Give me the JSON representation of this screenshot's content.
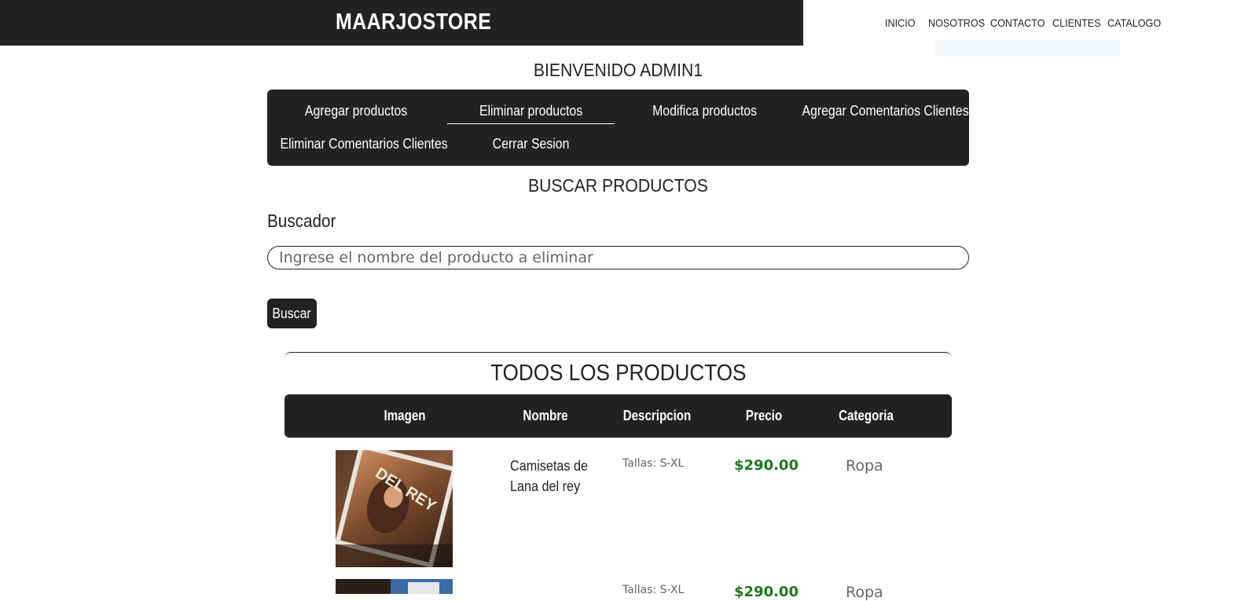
{
  "header": {
    "brand": "MAARJOSTORE",
    "nav": [
      "INICIO",
      "NOSOTROS",
      "CONTACTO",
      "CLIENTES",
      "CATALOGO"
    ]
  },
  "welcome": "BIENVENIDO ADMIN1",
  "admin_menu": {
    "items": [
      "Agregar productos",
      "Eliminar productos",
      "Modifica productos",
      "Agregar Comentarios Clientes",
      "Eliminar Comentarios Clientes",
      "Cerrar Sesion"
    ],
    "active": "Eliminar productos"
  },
  "search": {
    "title": "BUSCAR PRODUCTOS",
    "label": "Buscador",
    "placeholder": "Ingrese el nombre del producto a eliminar",
    "button": "Buscar"
  },
  "products": {
    "title": "TODOS LOS PRODUCTOS",
    "columns": [
      "Imagen",
      "Nombre",
      "Descripcion",
      "Precio",
      "Categoria"
    ],
    "rows": [
      {
        "image": "lana-del-rey-album-photo",
        "name": "Camisetas de Lana del rey",
        "description": "Tallas: S-XL",
        "price": "$290.00",
        "category": "Ropa"
      },
      {
        "image": "product-photo",
        "name": "",
        "description": "Tallas: S-XL",
        "price": "$290.00",
        "category": "Ropa"
      }
    ]
  },
  "colors": {
    "dark": "#222222",
    "price": "#1a7a1a",
    "muted": "#666666"
  }
}
